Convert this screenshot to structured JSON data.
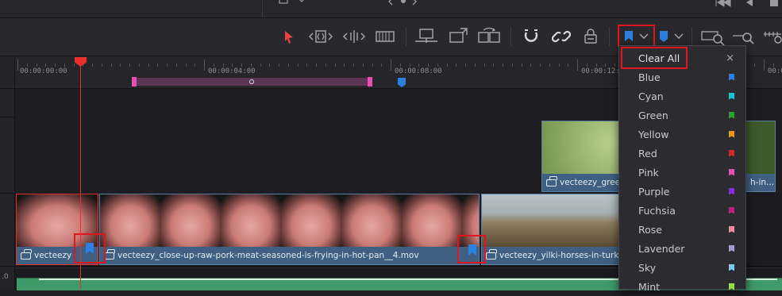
{
  "timecodes": [
    "00:00:00:00",
    "00:00:04:00",
    "00:00:08:00",
    "00:00:12:0",
    "00:0"
  ],
  "clips": {
    "meat_short": "vecteezy",
    "meat_long": "vecteezy_close-up-raw-pork-meat-seasoned-is-frying-in-hot-pan__4.mov",
    "greenery": "vecteezy_gree",
    "greenery_tail": "h-in...",
    "horses": "vecteezy_yilki-horses-in-turk"
  },
  "track_header_label": ".0",
  "menu": {
    "clear_all": "Clear All",
    "close": "×",
    "items": [
      {
        "label": "Blue",
        "color": "#2d7fe0"
      },
      {
        "label": "Cyan",
        "color": "#19c4d8"
      },
      {
        "label": "Green",
        "color": "#2ea22e"
      },
      {
        "label": "Yellow",
        "color": "#e69a1a"
      },
      {
        "label": "Red",
        "color": "#d42a22"
      },
      {
        "label": "Pink",
        "color": "#e84fb4"
      },
      {
        "label": "Purple",
        "color": "#8a2be2"
      },
      {
        "label": "Fuchsia",
        "color": "#c2207a"
      },
      {
        "label": "Rose",
        "color": "#f08aa0"
      },
      {
        "label": "Lavender",
        "color": "#a89ad8"
      },
      {
        "label": "Sky",
        "color": "#7cc8f0"
      },
      {
        "label": "Mint",
        "color": "#8fe04a"
      }
    ]
  },
  "colors": {
    "playhead": "#e8302a",
    "highlight": "#e0161e",
    "marker_blue": "#2d7fe0",
    "clip_label_bg": "#3f5f83",
    "audio_wave": "#3f9a6a"
  },
  "icons": [
    "select-arrow-icon",
    "trim-icon",
    "dynamic-trim-icon",
    "blade-icon",
    "insert-clip-icon",
    "overwrite-clip-icon",
    "replace-clip-icon",
    "snapping-icon",
    "linked-selection-icon",
    "position-lock-icon",
    "flag-icon",
    "marker-icon",
    "zoom-icon",
    "chevron-down-icon",
    "close-icon",
    "camera-icon"
  ]
}
